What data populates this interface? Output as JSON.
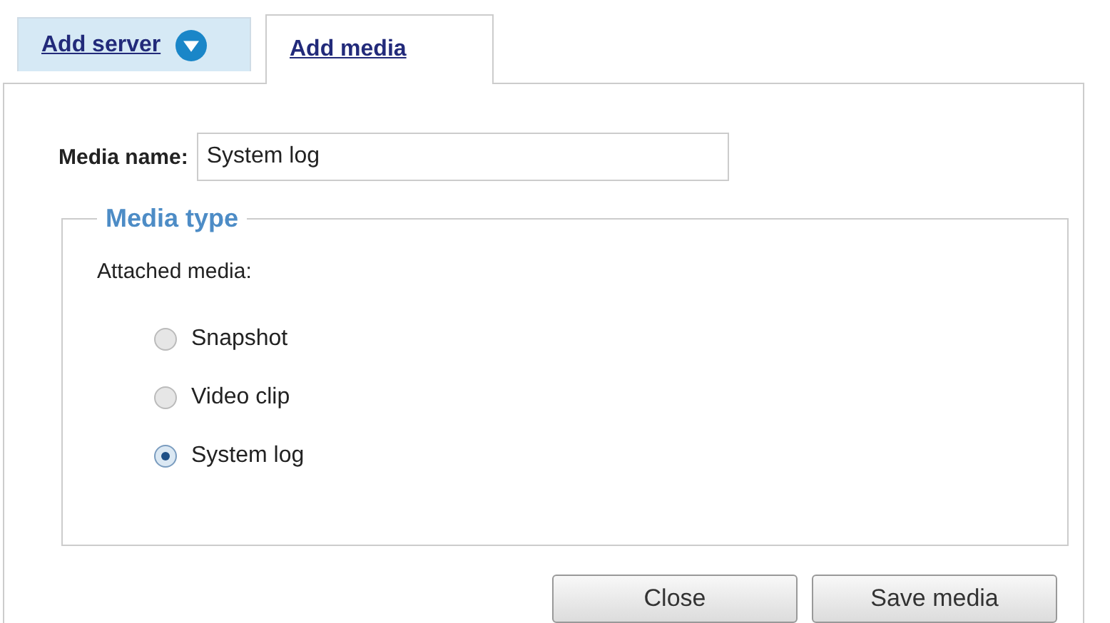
{
  "tabs": [
    {
      "label": "Add server",
      "selected": false,
      "dropdown": true
    },
    {
      "label": "Add media",
      "selected": true,
      "dropdown": false
    }
  ],
  "media_name": {
    "label": "Media name:",
    "value": "System log"
  },
  "media_type": {
    "legend": "Media type",
    "prompt": "Attached media:",
    "options": [
      {
        "label": "Snapshot",
        "selected": false
      },
      {
        "label": "Video clip",
        "selected": false
      },
      {
        "label": "System log",
        "selected": true
      }
    ]
  },
  "buttons": [
    "Close",
    "Save media"
  ]
}
